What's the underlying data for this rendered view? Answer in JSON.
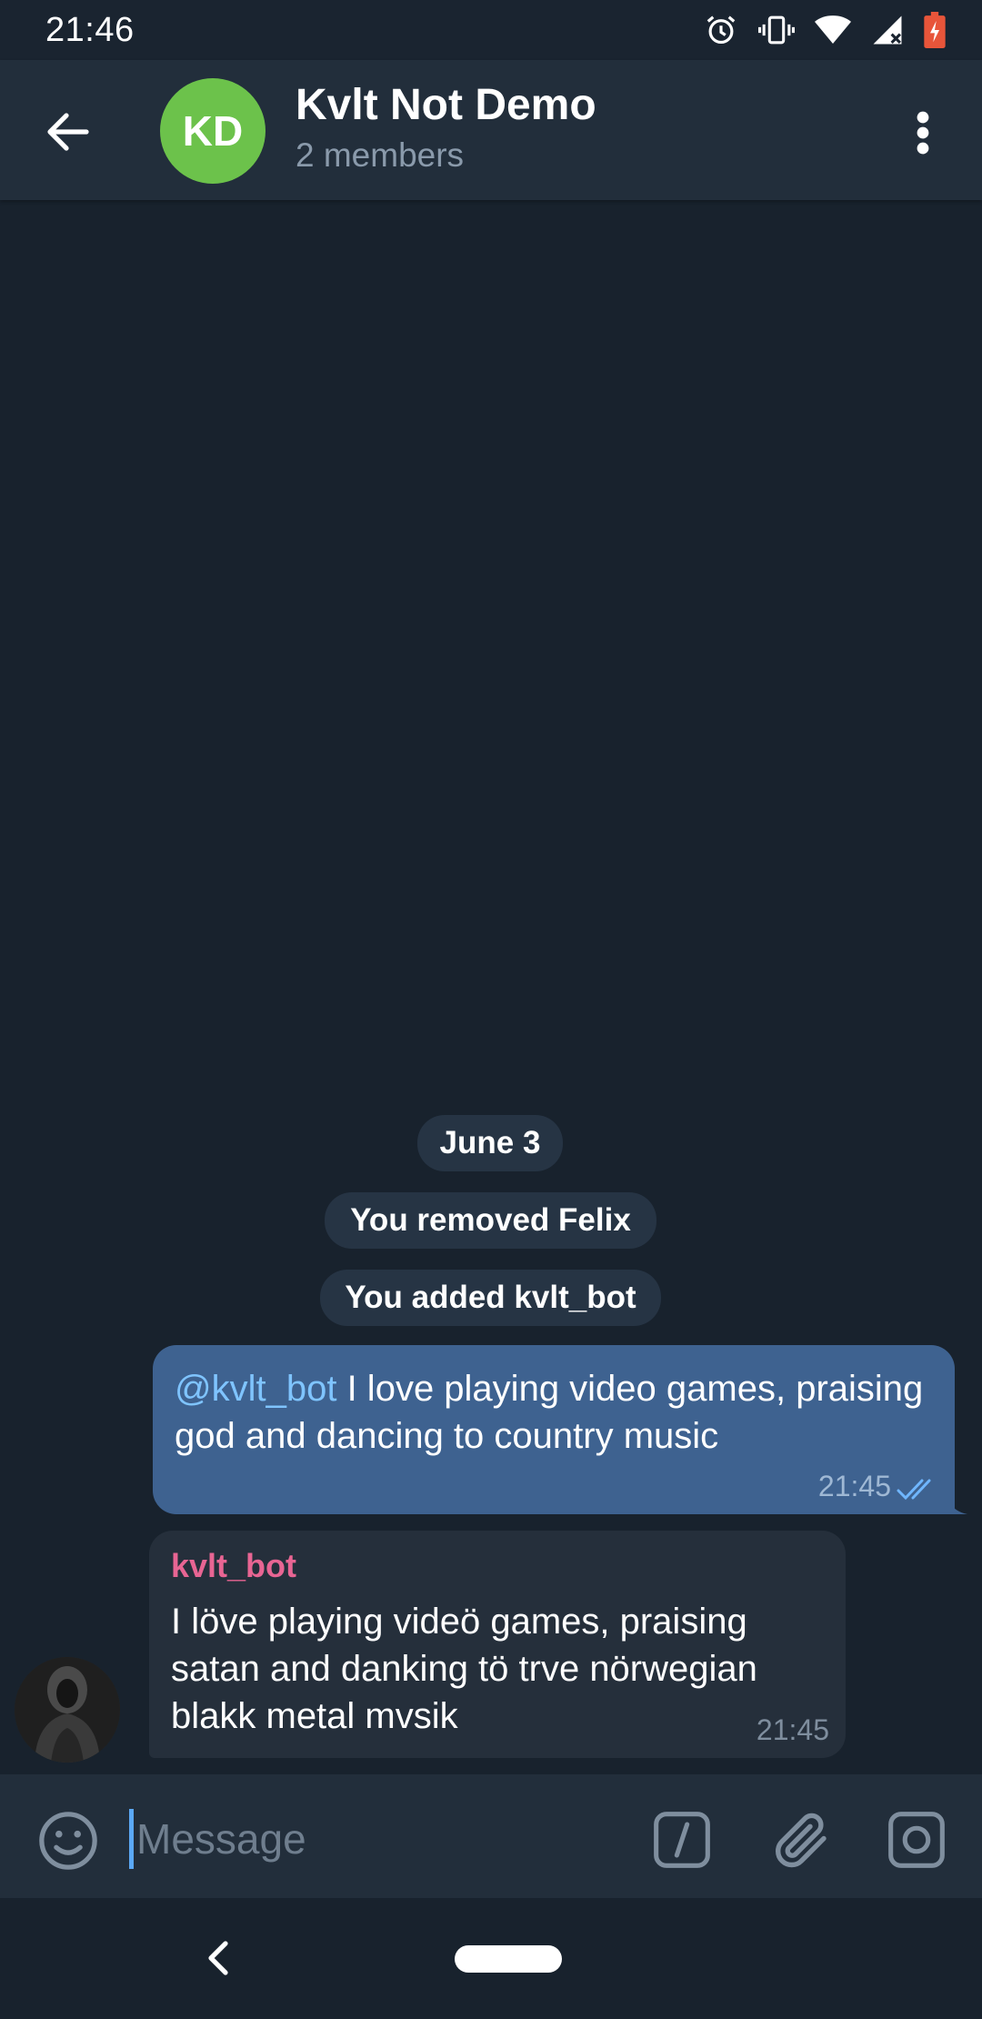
{
  "status_bar": {
    "time": "21:46"
  },
  "header": {
    "avatar_initials": "KD",
    "title": "Kvlt Not Demo",
    "subtitle": "2 members"
  },
  "service_messages": {
    "date": "June 3",
    "removed": "You removed Felix",
    "added": "You added kvlt_bot"
  },
  "outgoing_message": {
    "mention": "@kvlt_bot",
    "text": " I love playing video games, praising god and dancing to country music",
    "time": "21:45"
  },
  "incoming_message": {
    "sender": "kvlt_bot",
    "text": "I löve playing videö games, praising satan and danking tö trve nörwegian blakk metal mvsik",
    "time": "21:45"
  },
  "composer": {
    "placeholder": "Message",
    "value": ""
  },
  "colors": {
    "background": "#18222d",
    "header": "#222e3b",
    "avatar": "#6cc24b",
    "outgoing_bubble": "#3e6290",
    "incoming_bubble": "#252f3b",
    "mention": "#7fc4ff",
    "sender_name": "#e86593",
    "accent": "#5ba8f5"
  },
  "icons": [
    "alarm-icon",
    "vibrate-icon",
    "wifi-icon",
    "signal-icon",
    "battery-icon",
    "back-arrow-icon",
    "more-vert-icon",
    "double-check-icon",
    "emoji-icon",
    "bot-command-icon",
    "attach-icon",
    "camera-icon",
    "nav-back-icon",
    "nav-home-pill"
  ]
}
